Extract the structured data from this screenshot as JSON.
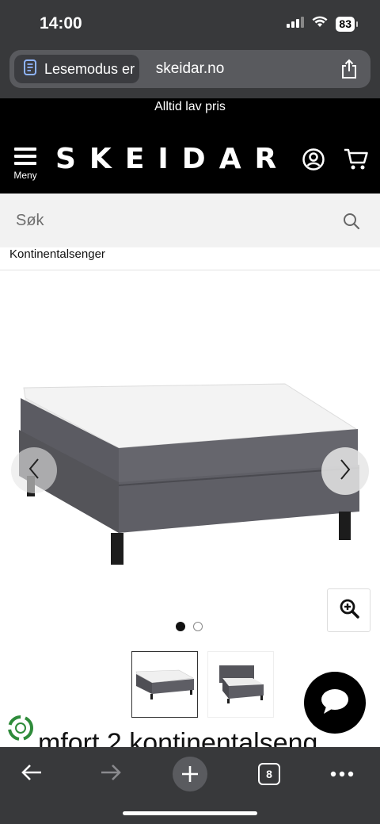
{
  "status_bar": {
    "time": "14:00",
    "battery": "83"
  },
  "browser": {
    "reader_label": "Lesemodus er",
    "domain": "skeidar.no"
  },
  "site": {
    "promo": "Alltid lav pris",
    "logo": "SKEIDAR",
    "menu_label": "Meny"
  },
  "search": {
    "placeholder": "Søk"
  },
  "breadcrumb": "Kontinentalsenger",
  "gallery": {
    "image_count": 2,
    "active_index": 0
  },
  "product": {
    "title_partial": "mfort 2 kontinentalseng"
  },
  "toolbar": {
    "tab_count": "8"
  },
  "icons": [
    "reader-icon",
    "share-icon",
    "menu-icon",
    "account-icon",
    "cart-icon",
    "search-icon",
    "chevron-left-icon",
    "chevron-right-icon",
    "zoom-icon",
    "chat-icon",
    "recycle-icon",
    "back-arrow-icon",
    "forward-arrow-icon",
    "plus-icon",
    "tabs-icon",
    "more-icon"
  ],
  "colors": {
    "chrome": "#38393b",
    "header": "#000000",
    "search_bg": "#f2f2f2"
  }
}
